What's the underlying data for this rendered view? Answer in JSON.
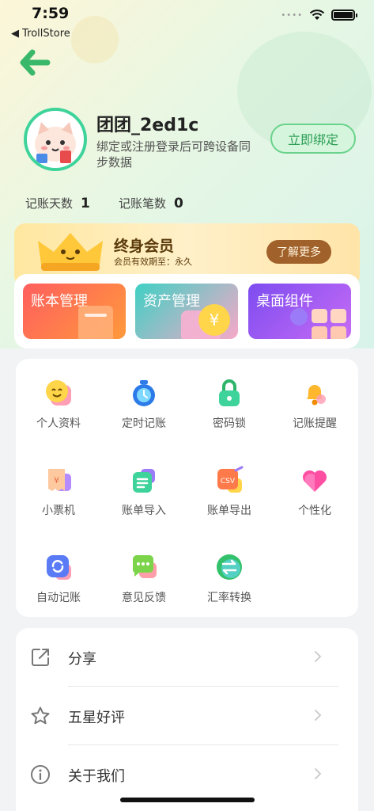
{
  "status_bar": {
    "time": "7:59",
    "back_app": "◀ TrollStore",
    "signal_dots": "••••"
  },
  "profile": {
    "username": "团团_2ed1c",
    "bind_hint": "绑定或注册登录后可跨设备同步数据",
    "bind_button": "立即绑定",
    "stats": [
      {
        "label": "记账天数",
        "value": "1"
      },
      {
        "label": "记账笔数",
        "value": "0"
      }
    ]
  },
  "vip": {
    "title": "终身会员",
    "expiry": "会员有效期至：永久",
    "button": "了解更多"
  },
  "features": [
    {
      "label": "账本管理",
      "color": "#ff6a4a"
    },
    {
      "label": "资产管理",
      "color": "#4fc9c0"
    },
    {
      "label": "桌面组件",
      "color": "#8a5cf0"
    }
  ],
  "grid": [
    {
      "label": "个人资料",
      "icon": "smile-face-icon"
    },
    {
      "label": "定时记账",
      "icon": "stopwatch-icon"
    },
    {
      "label": "密码锁",
      "icon": "lock-icon"
    },
    {
      "label": "记账提醒",
      "icon": "bell-icon"
    },
    {
      "label": "小票机",
      "icon": "receipt-icon"
    },
    {
      "label": "账单导入",
      "icon": "import-doc-icon"
    },
    {
      "label": "账单导出",
      "icon": "csv-export-icon"
    },
    {
      "label": "个性化",
      "icon": "heart-icon"
    },
    {
      "label": "自动记账",
      "icon": "auto-refresh-icon"
    },
    {
      "label": "意见反馈",
      "icon": "chat-bubble-icon"
    },
    {
      "label": "汇率转换",
      "icon": "exchange-icon"
    }
  ],
  "list": [
    {
      "label": "分享",
      "icon": "share-icon"
    },
    {
      "label": "五星好评",
      "icon": "star-icon"
    },
    {
      "label": "关于我们",
      "icon": "info-icon"
    }
  ]
}
